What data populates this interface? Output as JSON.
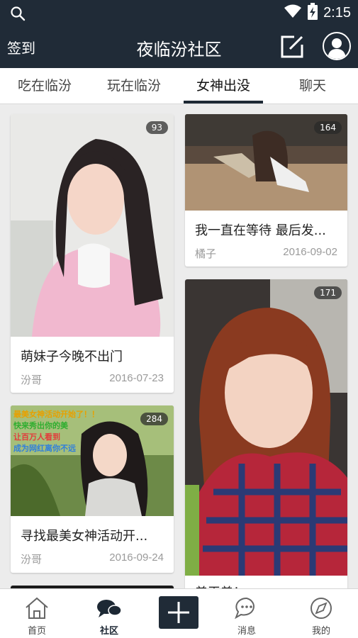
{
  "status_bar": {
    "time": "2:15"
  },
  "app_bar": {
    "left_action": "签到",
    "title": "夜临汾社区"
  },
  "tabs": [
    {
      "label": "吃在临汾"
    },
    {
      "label": "玩在临汾"
    },
    {
      "label": "女神出没"
    },
    {
      "label": "聊天"
    }
  ],
  "cards": [
    {
      "count": "93",
      "title": "萌妹子今晚不出门",
      "author": "汾哥",
      "date": "2016-07-23"
    },
    {
      "count": "164",
      "title": "我一直在等待 最后发...",
      "author": "橘子",
      "date": "2016-09-02"
    },
    {
      "count": "284",
      "title": "寻找最美女神活动开...",
      "author": "汾哥",
      "date": "2016-09-24",
      "overlay_lines": [
        "最美女神活动开始了！！",
        "快来秀出你的美",
        "让百万人看到",
        "成为网红离你不远"
      ]
    },
    {
      "count": "171",
      "title": "盖王盖！"
    }
  ],
  "bottom_nav": [
    {
      "label": "首页"
    },
    {
      "label": "社区"
    },
    {
      "label": "消息"
    },
    {
      "label": "我的"
    }
  ],
  "colors": {
    "header_bg": "#202b37",
    "accent": "#1d2834",
    "page_bg": "#ececec"
  }
}
